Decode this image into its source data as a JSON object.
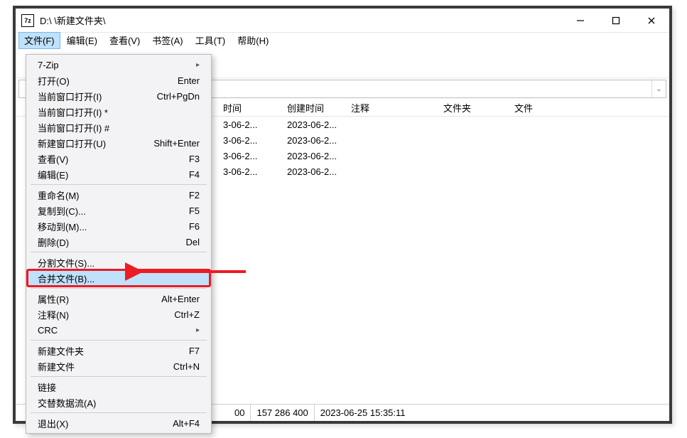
{
  "title": "D:\\       \\新建文件夹\\",
  "app_icon_text": "7z",
  "menus": {
    "file": "文件(F)",
    "edit": "编辑(E)",
    "view": "查看(V)",
    "bookm": "书签(A)",
    "tools": "工具(T)",
    "help": "帮助(H)"
  },
  "columns": {
    "mod": "时间",
    "cre": "创建时间",
    "com": "注释",
    "fold": "文件夹",
    "file": "文件"
  },
  "rows": [
    {
      "mod": "3-06-2...",
      "cre": "2023-06-2..."
    },
    {
      "mod": "3-06-2...",
      "cre": "2023-06-2..."
    },
    {
      "mod": "3-06-2...",
      "cre": "2023-06-2..."
    },
    {
      "mod": "3-06-2...",
      "cre": "2023-06-2..."
    }
  ],
  "status": {
    "seg1": "00",
    "seg2": "157 286 400",
    "seg3": "2023-06-25 15:35:11"
  },
  "file_menu": [
    {
      "kind": "item",
      "label": "7-Zip",
      "accel": "",
      "sub": true
    },
    {
      "kind": "item",
      "label": "打开(O)",
      "accel": "Enter"
    },
    {
      "kind": "item",
      "label": "当前窗口打开(I)",
      "accel": "Ctrl+PgDn"
    },
    {
      "kind": "item",
      "label": "当前窗口打开(I) *",
      "accel": ""
    },
    {
      "kind": "item",
      "label": "当前窗口打开(I) #",
      "accel": ""
    },
    {
      "kind": "item",
      "label": "新建窗口打开(U)",
      "accel": "Shift+Enter"
    },
    {
      "kind": "item",
      "label": "查看(V)",
      "accel": "F3"
    },
    {
      "kind": "item",
      "label": "编辑(E)",
      "accel": "F4"
    },
    {
      "kind": "sep"
    },
    {
      "kind": "item",
      "label": "重命名(M)",
      "accel": "F2"
    },
    {
      "kind": "item",
      "label": "复制到(C)...",
      "accel": "F5"
    },
    {
      "kind": "item",
      "label": "移动到(M)...",
      "accel": "F6"
    },
    {
      "kind": "item",
      "label": "删除(D)",
      "accel": "Del"
    },
    {
      "kind": "sep"
    },
    {
      "kind": "item",
      "label": "分割文件(S)...",
      "accel": ""
    },
    {
      "kind": "item",
      "label": "合并文件(B)...",
      "accel": "",
      "hl": true,
      "boxed": true
    },
    {
      "kind": "sep"
    },
    {
      "kind": "item",
      "label": "属性(R)",
      "accel": "Alt+Enter"
    },
    {
      "kind": "item",
      "label": "注释(N)",
      "accel": "Ctrl+Z"
    },
    {
      "kind": "item",
      "label": "CRC",
      "accel": "",
      "sub": true
    },
    {
      "kind": "sep"
    },
    {
      "kind": "item",
      "label": "新建文件夹",
      "accel": "F7"
    },
    {
      "kind": "item",
      "label": "新建文件",
      "accel": "Ctrl+N"
    },
    {
      "kind": "sep"
    },
    {
      "kind": "item",
      "label": "链接",
      "accel": ""
    },
    {
      "kind": "item",
      "label": "交替数据流(A)",
      "accel": ""
    },
    {
      "kind": "sep"
    },
    {
      "kind": "item",
      "label": "退出(X)",
      "accel": "Alt+F4"
    }
  ]
}
